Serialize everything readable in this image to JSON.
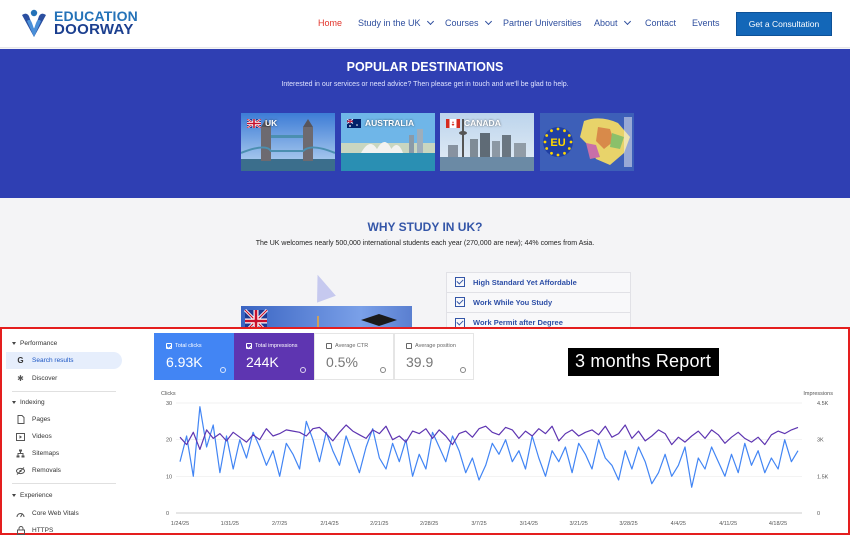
{
  "logo": {
    "line1": "EDUCATION",
    "line2": "DOORWAY",
    "colors": {
      "primary": "#2472b8",
      "dark": "#1b3f8f"
    }
  },
  "nav": {
    "items": [
      {
        "label": "Home",
        "active": true,
        "caret": false
      },
      {
        "label": "Study in the UK",
        "active": false,
        "caret": true
      },
      {
        "label": "Courses",
        "active": false,
        "caret": true
      },
      {
        "label": "Partner Universities",
        "active": false,
        "caret": false
      },
      {
        "label": "About",
        "active": false,
        "caret": true
      },
      {
        "label": "Contact",
        "active": false,
        "caret": false
      },
      {
        "label": "Events",
        "active": false,
        "caret": false
      }
    ],
    "cta": "Get a Consultation"
  },
  "hero": {
    "title": "POPULAR DESTINATIONS",
    "subtitle": "Interested in our services or need advice? Then please get in touch and we'll be glad to help.",
    "destinations": [
      {
        "label": "UK"
      },
      {
        "label": "AUSTRALIA"
      },
      {
        "label": "CANADA"
      },
      {
        "label": ""
      }
    ],
    "eu_text": "EU"
  },
  "why": {
    "title": "WHY STUDY IN UK?",
    "subtitle": "The UK welcomes nearly 500,000 international students each year (270,000 are new); 44% comes from Asia.",
    "points": [
      "High Standard Yet Affordable",
      "Work While You Study",
      "Work Permit after Degree"
    ]
  },
  "sidebar": {
    "sections": [
      {
        "title": "Performance",
        "items": [
          {
            "label": "Search results",
            "icon": "google-g-icon",
            "selected": true
          },
          {
            "label": "Discover",
            "icon": "asterisk-icon",
            "selected": false
          }
        ]
      },
      {
        "title": "Indexing",
        "items": [
          {
            "label": "Pages",
            "icon": "page-icon",
            "selected": false
          },
          {
            "label": "Videos",
            "icon": "video-icon",
            "selected": false
          },
          {
            "label": "Sitemaps",
            "icon": "sitemap-icon",
            "selected": false
          },
          {
            "label": "Removals",
            "icon": "eye-off-icon",
            "selected": false
          }
        ]
      },
      {
        "title": "Experience",
        "items": [
          {
            "label": "Core Web Vitals",
            "icon": "speed-icon",
            "selected": false
          },
          {
            "label": "HTTPS",
            "icon": "lock-icon",
            "selected": false
          }
        ]
      }
    ]
  },
  "metrics": [
    {
      "label": "Total clicks",
      "value": "6.93K",
      "checked": true,
      "color": "#4285f4"
    },
    {
      "label": "Total impressions",
      "value": "244K",
      "checked": true,
      "color": "#5e35b1"
    },
    {
      "label": "Average CTR",
      "value": "0.5%",
      "checked": false,
      "color": ""
    },
    {
      "label": "Average position",
      "value": "39.9",
      "checked": false,
      "color": ""
    }
  ],
  "report_label": "3 months Report",
  "chart_data": {
    "type": "line",
    "left_axis": {
      "label": "Clicks",
      "ticks": [
        "30",
        "20",
        "10",
        "0"
      ],
      "ylim": [
        0,
        30
      ]
    },
    "right_axis": {
      "label": "Impressions",
      "ticks": [
        "4.5K",
        "3K",
        "1.5K",
        "0"
      ],
      "ylim": [
        0,
        4500
      ]
    },
    "x_ticks": [
      "1/24/25",
      "1/31/25",
      "2/7/25",
      "2/14/25",
      "2/21/25",
      "2/28/25",
      "3/7/25",
      "3/14/25",
      "3/21/25",
      "3/28/25",
      "4/4/25",
      "4/11/25",
      "4/18/25"
    ],
    "grid": true,
    "series": [
      {
        "name": "",
        "axis": "left",
        "color": "#4285f4",
        "values": [
          14,
          21,
          10,
          29,
          18,
          24,
          11,
          21,
          12,
          20,
          15,
          22,
          18,
          13,
          17,
          10,
          19,
          16,
          12,
          25,
          20,
          14,
          22,
          17,
          13,
          21,
          16,
          11,
          18,
          23,
          15,
          12,
          19,
          14,
          20,
          10,
          16,
          12,
          22,
          18,
          14,
          21,
          17,
          11,
          15,
          9,
          13,
          19,
          16,
          20,
          14,
          17,
          12,
          21,
          15,
          10,
          17,
          14,
          18,
          11,
          19,
          16,
          12,
          20,
          15,
          13,
          9,
          17,
          12,
          18,
          14,
          8,
          11,
          16,
          10,
          13,
          18,
          7,
          15,
          12,
          18,
          14,
          10,
          16,
          11,
          19,
          13,
          17,
          11,
          15,
          12,
          20,
          14,
          17
        ]
      },
      {
        "name": "",
        "axis": "right",
        "color": "#5e35b1",
        "values": [
          3100,
          2800,
          3300,
          2600,
          3400,
          3050,
          3250,
          2950,
          3300,
          3100,
          2900,
          3200,
          3000,
          3450,
          3150,
          3250,
          3400,
          3350,
          3300,
          3150,
          3450,
          3500,
          3250,
          2950,
          3300,
          3600,
          3350,
          3200,
          3050,
          3400,
          3250,
          3550,
          3000,
          3150,
          2900,
          3350,
          3250,
          3450,
          3050,
          3400,
          3150,
          2800,
          3250,
          3350,
          3100,
          3450,
          3550,
          3300,
          3200,
          3500,
          3400,
          3050,
          3350,
          3150,
          3450,
          3250,
          3550,
          2950,
          3250,
          3400,
          3150,
          3300,
          3400,
          3200,
          3550,
          3100,
          3250,
          3600,
          3050,
          3350,
          2950,
          3150,
          3400,
          3250,
          2800,
          3100,
          2900,
          3150,
          3350,
          3050,
          3400,
          3200,
          2850,
          3100,
          3300,
          3050,
          2900,
          3100,
          2800,
          3200,
          3350,
          3250,
          3400,
          3500
        ]
      }
    ]
  }
}
